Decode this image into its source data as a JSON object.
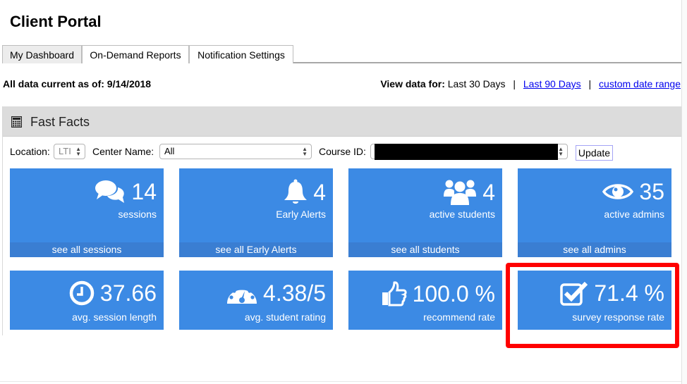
{
  "header": {
    "title": "Client Portal"
  },
  "tabs": [
    {
      "label": "My Dashboard",
      "active": true
    },
    {
      "label": "On-Demand Reports",
      "active": false
    },
    {
      "label": "Notification Settings",
      "active": false
    }
  ],
  "status": {
    "data_current_as_of": "All data current as of: 9/14/2018"
  },
  "view_data": {
    "label": "View data for:",
    "current": "Last 30 Days",
    "separator": "|",
    "links": [
      "Last 90 Days",
      "custom date range"
    ]
  },
  "fast_facts": {
    "title": "Fast Facts",
    "icon": "calculator-icon",
    "filters": {
      "location_label": "Location:",
      "location_value": "LTI",
      "center_label": "Center Name:",
      "center_value": "All",
      "course_label": "Course ID:",
      "course_value": "[redacted]",
      "update_label": "Update"
    },
    "tiles": [
      {
        "icon": "comments-icon",
        "value": "14",
        "label": "sessions",
        "footer": "see all sessions"
      },
      {
        "icon": "bell-icon",
        "value": "4",
        "label": "Early Alerts",
        "footer": "see all Early Alerts"
      },
      {
        "icon": "users-icon",
        "value": "4",
        "label": "active students",
        "footer": "see all students"
      },
      {
        "icon": "eye-icon",
        "value": "35",
        "label": "active admins",
        "footer": "see all admins"
      },
      {
        "icon": "clock-icon",
        "value": "37.66",
        "label": "avg. session length"
      },
      {
        "icon": "dashboard-gauge-icon",
        "value": "4.38/5",
        "label": "avg. student rating"
      },
      {
        "icon": "thumbs-up-icon",
        "value": "100.0 %",
        "label": "recommend rate"
      },
      {
        "icon": "checkbox-checked-icon",
        "value": "71.4 %",
        "label": "survey response rate",
        "highlighted": true
      }
    ]
  },
  "colors": {
    "tile": "#3c8ae4",
    "tile_footer": "#3a7ed2",
    "highlight": "#ff0000",
    "panel_header": "#dcdcdc"
  }
}
